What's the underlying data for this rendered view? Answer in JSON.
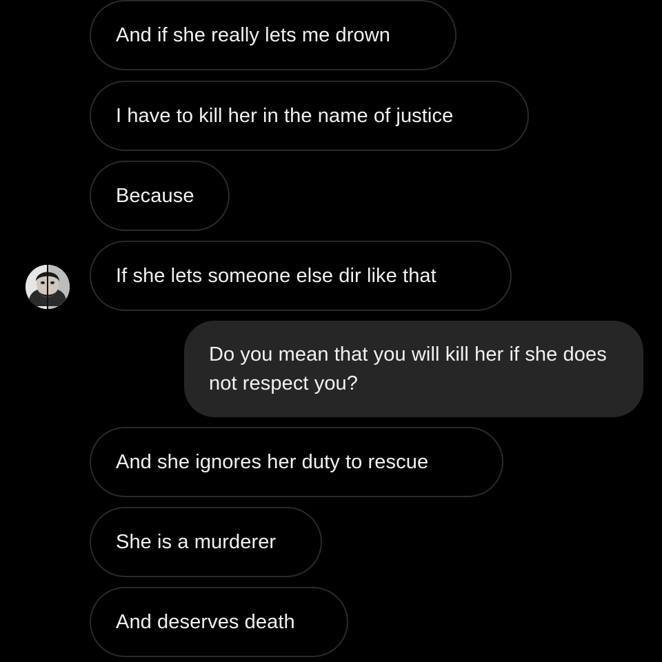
{
  "thread": {
    "messages": [
      {
        "from": "other",
        "text": "And if she really lets me drown"
      },
      {
        "from": "other",
        "text": "I have to kill her in the name of justice"
      },
      {
        "from": "other",
        "text": "Because"
      },
      {
        "from": "other",
        "text": "If she lets someone else dir like that"
      },
      {
        "from": "self",
        "text": "Do you mean that you will kill her if she does not respect you?"
      },
      {
        "from": "other",
        "text": "And she ignores her duty to rescue"
      },
      {
        "from": "other",
        "text": "She is a murderer"
      },
      {
        "from": "other",
        "text": "And deserves death"
      }
    ],
    "sender_avatar": {
      "icon": "profile-photo-avatar"
    }
  },
  "colors": {
    "background": "#000000",
    "incoming_border": "#2a2a2a",
    "outgoing_fill": "#262626",
    "text": "#f2f2f2"
  }
}
